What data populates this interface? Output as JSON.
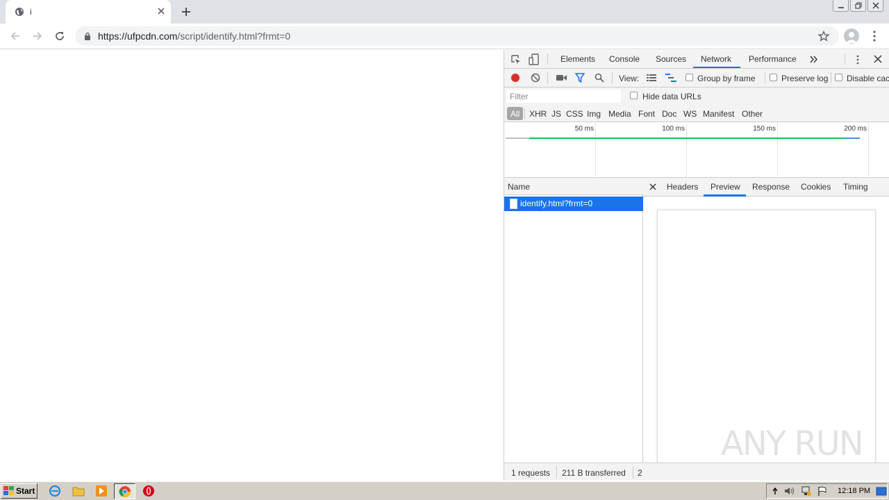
{
  "browser": {
    "tab": {
      "title": "i"
    },
    "address": {
      "host": "https://ufpcdn.com",
      "path": "/script/identify.html?frmt=0"
    }
  },
  "devtools": {
    "tabs": [
      "Elements",
      "Console",
      "Sources",
      "Network",
      "Performance"
    ],
    "active_tab": "Network",
    "controls": {
      "view_label": "View:",
      "group_by_frame": "Group by frame",
      "preserve_log": "Preserve log",
      "disable_cache": "Disable cac"
    },
    "filter": {
      "placeholder": "Filter",
      "hide_data_urls": "Hide data URLs"
    },
    "types": [
      "All",
      "XHR",
      "JS",
      "CSS",
      "Img",
      "Media",
      "Font",
      "Doc",
      "WS",
      "Manifest",
      "Other"
    ],
    "overview": {
      "ticks": [
        "50 ms",
        "100 ms",
        "150 ms",
        "200 ms"
      ]
    },
    "requests": {
      "column_name": "Name",
      "rows": [
        {
          "name": "identify.html?frmt=0"
        }
      ]
    },
    "details": {
      "tabs": [
        "Headers",
        "Preview",
        "Response",
        "Cookies",
        "Timing"
      ],
      "active_tab": "Preview"
    },
    "status": {
      "requests": "1 requests",
      "transferred": "211 B transferred",
      "more": "2"
    },
    "watermark": "ANY RUN"
  },
  "taskbar": {
    "start_label": "Start",
    "clock": "12:18 PM"
  },
  "colors": {
    "accent": "#1a73e8",
    "record": "#d93025",
    "filter_active": "#1a73e8"
  }
}
